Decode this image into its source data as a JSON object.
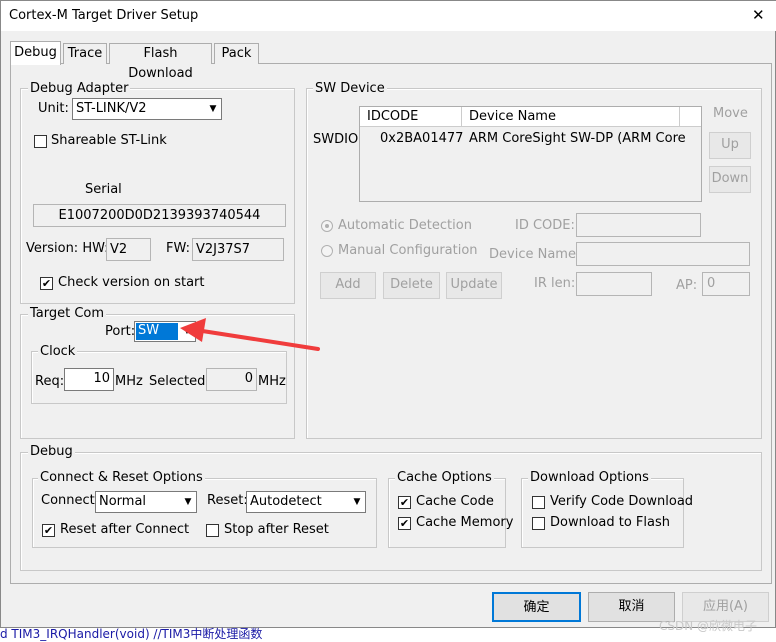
{
  "window": {
    "title": "Cortex-M Target Driver Setup",
    "close_glyph": "✕"
  },
  "tabs": [
    {
      "label": "Debug"
    },
    {
      "label": "Trace"
    },
    {
      "label": "Flash Download"
    },
    {
      "label": "Pack"
    }
  ],
  "debug_adapter": {
    "group_label": "Debug Adapter",
    "unit_label": "Unit:",
    "unit_value": "ST-LINK/V2",
    "shareable_label": "Shareable ST-Link",
    "shareable_checked": false,
    "serial_label": "Serial",
    "serial_value": "E1007200D0D2139393740544",
    "version_label": "Version: HW:",
    "hw_value": "V2",
    "fw_label": "FW:",
    "fw_value": "V2J37S7",
    "check_version_label": "Check version on start",
    "check_version_checked": true
  },
  "target_com": {
    "group_label": "Target Com",
    "port_label": "Port:",
    "port_value": "SW",
    "clock": {
      "group_label": "Clock",
      "req_label": "Req:",
      "req_value": "10",
      "mhz1": "MHz",
      "selected_label": "Selected:",
      "selected_value": "0",
      "mhz2": "MHz"
    }
  },
  "sw_device": {
    "group_label": "SW Device",
    "row_label": "SWDIO",
    "columns": [
      "IDCODE",
      "Device Name"
    ],
    "rows": [
      {
        "idcode": "0x2BA01477",
        "device_name": "ARM CoreSight SW-DP (ARM Core"
      }
    ],
    "move_label": "Move",
    "up_label": "Up",
    "down_label": "Down",
    "auto_detection_label": "Automatic Detection",
    "manual_config_label": "Manual Configuration",
    "id_code_label": "ID CODE:",
    "device_name_label": "Device Name:",
    "add_label": "Add",
    "delete_label": "Delete",
    "update_label": "Update",
    "ir_len_label": "IR len:",
    "ap_label": "AP:",
    "ap_value": "0"
  },
  "debug": {
    "group_label": "Debug",
    "connect_reset": {
      "group_label": "Connect & Reset Options",
      "connect_label": "Connect:",
      "connect_value": "Normal",
      "reset_label": "Reset:",
      "reset_value": "Autodetect",
      "reset_after_connect_label": "Reset after Connect",
      "reset_after_connect_checked": true,
      "stop_after_reset_label": "Stop after Reset",
      "stop_after_reset_checked": false
    },
    "cache_options": {
      "group_label": "Cache Options",
      "cache_code_label": "Cache Code",
      "cache_code_checked": true,
      "cache_memory_label": "Cache Memory",
      "cache_memory_checked": true
    },
    "download_options": {
      "group_label": "Download Options",
      "verify_label": "Verify Code Download",
      "verify_checked": false,
      "download_flash_label": "Download to Flash",
      "download_flash_checked": false
    }
  },
  "buttons": {
    "ok": "确定",
    "cancel": "取消",
    "apply": "应用(A)"
  },
  "background_code": "d TIM3_IRQHandler(void)  //TIM3中断处理函数",
  "watermark": "CSDN @欣微电子",
  "colors": {
    "annotation_arrow": "#f03c3c",
    "selection": "#0078d7"
  }
}
